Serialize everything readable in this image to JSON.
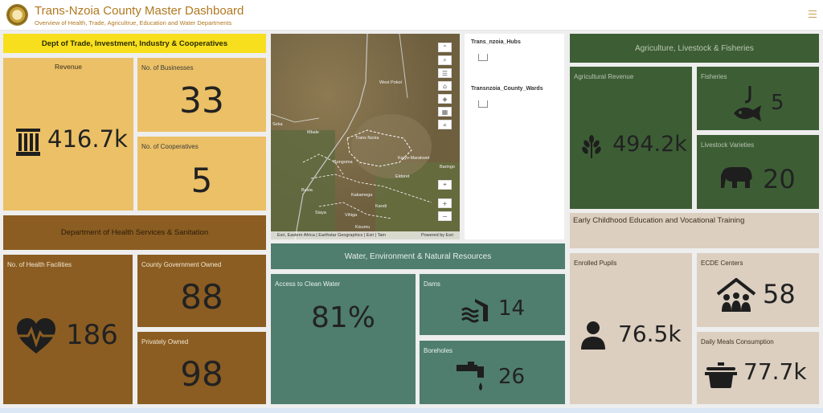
{
  "header": {
    "title": "Trans-Nzoia County Master Dashboard",
    "subtitle": "Overview of Health, Trade, Agricultrue, Education and Water Departments"
  },
  "trade": {
    "header": "Dept of Trade, Investment, Industry & Cooperatives",
    "revenue_label": "Revenue",
    "revenue_value": "416.7k",
    "businesses_label": "No. of Businesses",
    "businesses_value": "33",
    "cooperatives_label": "No. of Cooperatives",
    "cooperatives_value": "5"
  },
  "health": {
    "header": "Department of Health Services & Sanitation",
    "facilities_label": "No. of Health Facilities",
    "facilities_value": "186",
    "county_label": "County Government Owned",
    "county_value": "88",
    "private_label": "Privately Owned",
    "private_value": "98"
  },
  "map": {
    "places": [
      "West Pokot",
      "Trans Nzoia",
      "Mbale",
      "Bungoma",
      "Keiyo-Marakwet",
      "Eldoret",
      "Baringo",
      "Busia",
      "Kakamega",
      "Kandi",
      "Siaya",
      "Vihiga",
      "Kisumu",
      "Seka"
    ],
    "attribution": "Esri, Eastern Africa | Earthstar Geographics | Esri | Tam",
    "powered": "Powered by Esri"
  },
  "legend": {
    "layer1": "Trans_nzoia_Hubs",
    "layer2": "Transnzoia_County_Wards"
  },
  "water": {
    "header": "Water, Environment & Natural Resources",
    "clean_label": "Access to Clean Water",
    "clean_value": "81%",
    "dams_label": "Dams",
    "dams_value": "14",
    "boreholes_label": "Boreholes",
    "boreholes_value": "26"
  },
  "agri": {
    "header": "Agriculture, Livestock & Fisheries",
    "revenue_label": "Agricultural Revenue",
    "revenue_value": "494.2k",
    "fisheries_label": "Fisheries",
    "fisheries_value": "5",
    "livestock_label": "Livestock Varieties",
    "livestock_value": "20"
  },
  "edu": {
    "header": "Early Childhood Education and Vocational Training",
    "pupils_label": "Enrolled Pupils",
    "pupils_value": "76.5k",
    "ecde_label": "ECDE Centers",
    "ecde_value": "58",
    "meals_label": "Daily Meals Consumption",
    "meals_value": "77.7k"
  },
  "colors": {
    "yellow": "#f7df1e",
    "tan": "#ebc066",
    "brown": "#8b5d22",
    "teal": "#4f7d6e",
    "green": "#3d5e35",
    "cream": "#dccfc0"
  },
  "icons": [
    "bank-icon",
    "heart-pulse-icon",
    "waves-icon",
    "tap-icon",
    "wheat-icon",
    "fish-hook-icon",
    "elephant-icon",
    "person-icon",
    "people-house-icon",
    "pot-icon",
    "hamburger-menu-icon"
  ]
}
